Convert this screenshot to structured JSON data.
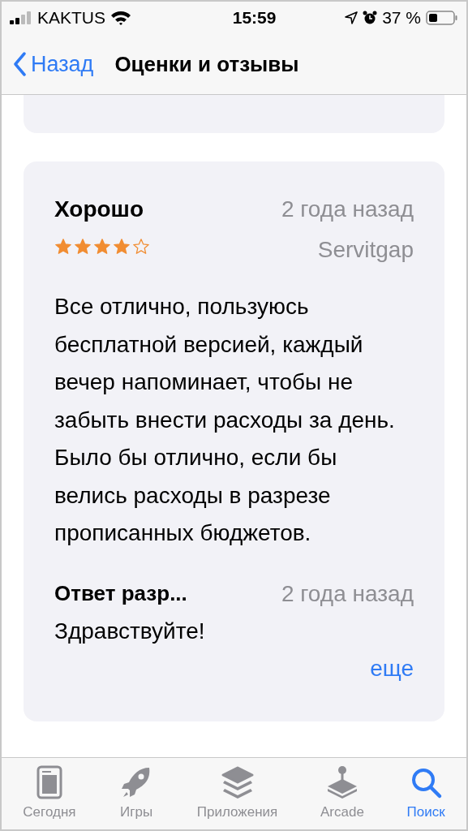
{
  "status_bar": {
    "carrier": "KAKTUS",
    "time": "15:59",
    "battery": "37 %"
  },
  "nav": {
    "back": "Назад",
    "title": "Оценки и отзывы"
  },
  "review": {
    "title": "Хорошо",
    "date": "2 года назад",
    "author": "Servitgap",
    "stars": 4,
    "body": "Все отлично, пользуюсь бесплатной версией, каждый вечер напоминает, чтобы не забыть внести расходы за день. Было бы отлично, если бы велись расходы в разрезе прописанных бюджетов.",
    "response": {
      "title": "Ответ разр...",
      "date": "2 года назад",
      "body": "Здравствуйте!",
      "more": "еще"
    }
  },
  "tabs": [
    {
      "label": "Сегодня",
      "kind": "today",
      "selected": false
    },
    {
      "label": "Игры",
      "kind": "games",
      "selected": false
    },
    {
      "label": "Приложения",
      "kind": "apps",
      "selected": false
    },
    {
      "label": "Arcade",
      "kind": "arcade",
      "selected": false
    },
    {
      "label": "Поиск",
      "kind": "search",
      "selected": true
    }
  ]
}
